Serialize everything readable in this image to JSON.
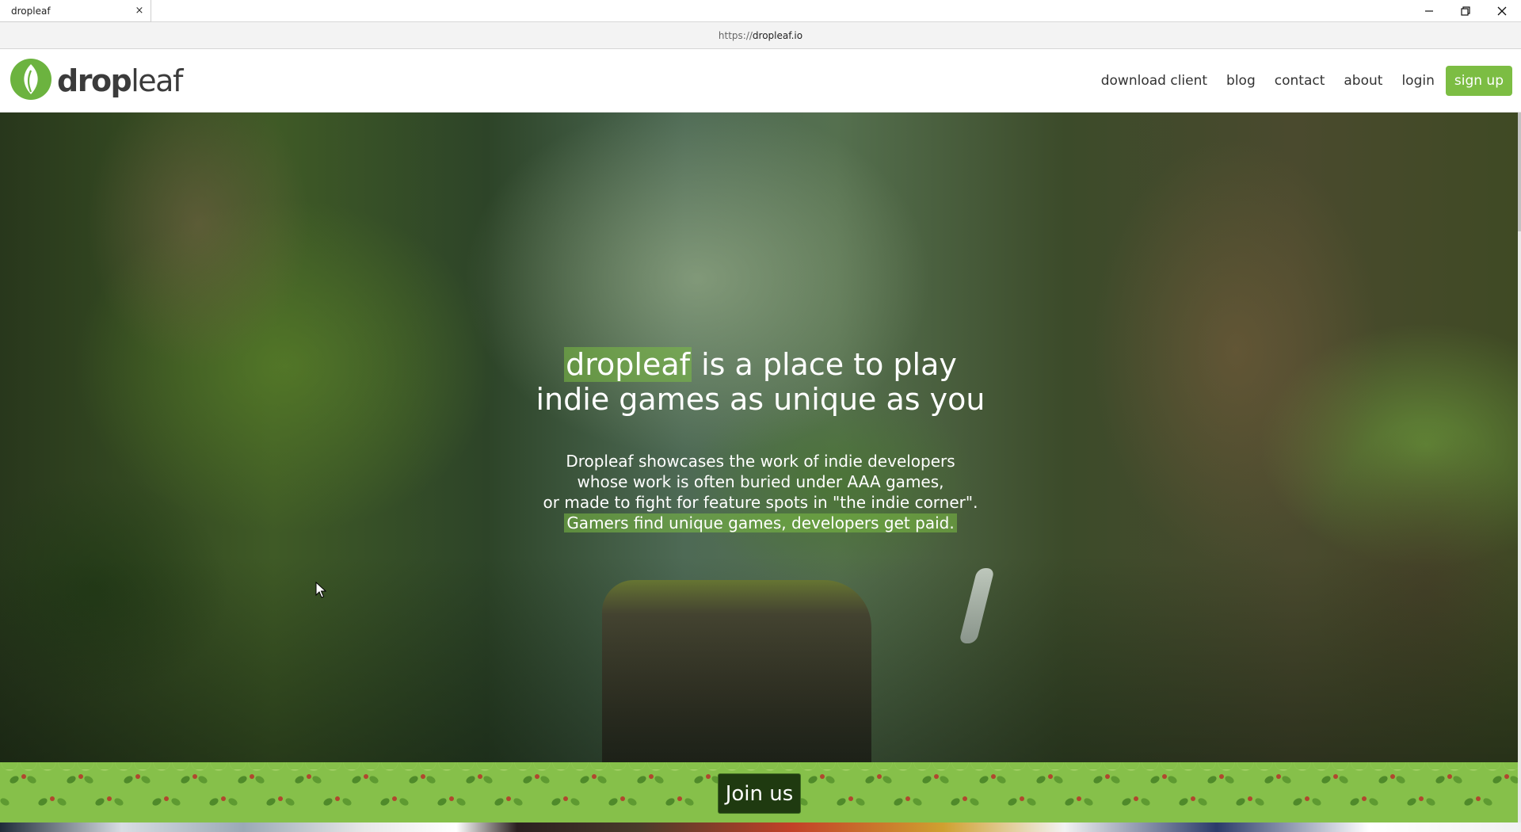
{
  "browser": {
    "tab_title": "dropleaf",
    "tab_close": "×",
    "url_prefix": "https://",
    "url_host": "dropleaf.io"
  },
  "header": {
    "logo_bold": "drop",
    "logo_light": "leaf",
    "nav": [
      {
        "label": "download client"
      },
      {
        "label": "blog"
      },
      {
        "label": "contact"
      },
      {
        "label": "about"
      },
      {
        "label": "login"
      }
    ],
    "signup_label": "sign up"
  },
  "hero": {
    "headline_highlight": "dropleaf",
    "headline_rest_line1": " is a place to play",
    "headline_line2": "indie games as unique as you",
    "sub_line1": "Dropleaf showcases the work of indie developers",
    "sub_line2": "whose work is often buried under AAA games,",
    "sub_line3": "or made to fight for feature spots in \"the indie corner\".",
    "sub_line4_highlight": "Gamers find unique games, developers get paid."
  },
  "cta": {
    "join_label": "Join us"
  },
  "colors": {
    "brand_green": "#7cbd43",
    "band_green": "#86c04a",
    "join_bg": "#1f3a10"
  },
  "icons": {
    "logo": "leaf-logo-icon",
    "cursor": "mouse-cursor-icon",
    "minimize": "minimize-icon",
    "restore": "restore-icon",
    "close": "close-icon"
  }
}
